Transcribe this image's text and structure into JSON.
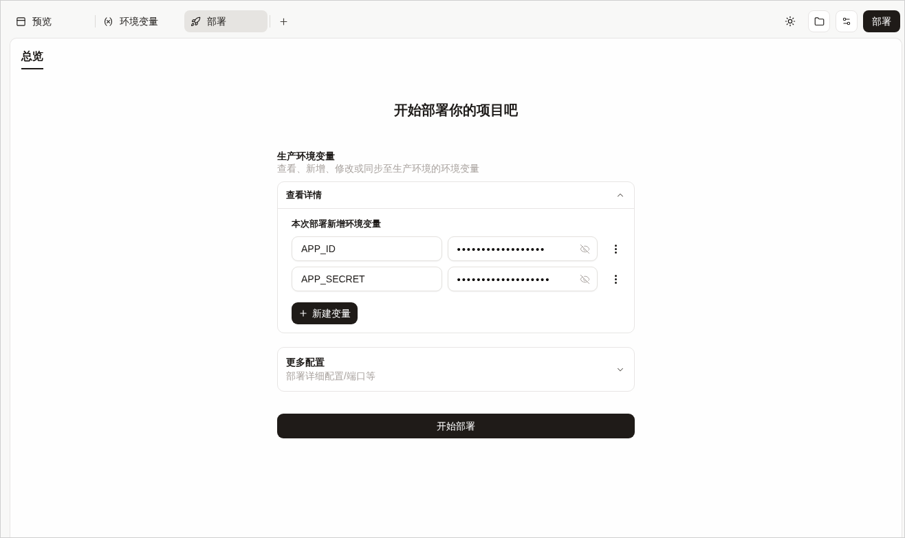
{
  "top_tabs": [
    {
      "label": "预览",
      "selected": false
    },
    {
      "label": "环境变量",
      "selected": false
    },
    {
      "label": "部署",
      "selected": true
    }
  ],
  "toolbar": {
    "deploy_button": "部署"
  },
  "panel_tabs": [
    {
      "label": "总览",
      "selected": true
    }
  ],
  "heading": "开始部署你的项目吧",
  "env_section": {
    "title": "生产环境变量",
    "subtitle": "查看、新增、修改或同步至生产环境的环境变量",
    "details": {
      "title": "查看详情",
      "expanded": true,
      "group_label": "本次部署新增环境变量",
      "variables": [
        {
          "name": "APP_ID",
          "value": "••••••••••••••••••",
          "revealed": false
        },
        {
          "name": "APP_SECRET",
          "value": "•••••••••••••••••••",
          "revealed": false
        }
      ],
      "add_button": "新建变量"
    }
  },
  "more_config": {
    "title": "更多配置",
    "subtitle": "部署详细配置/端口等",
    "expanded": false
  },
  "start_button": "开始部署"
}
